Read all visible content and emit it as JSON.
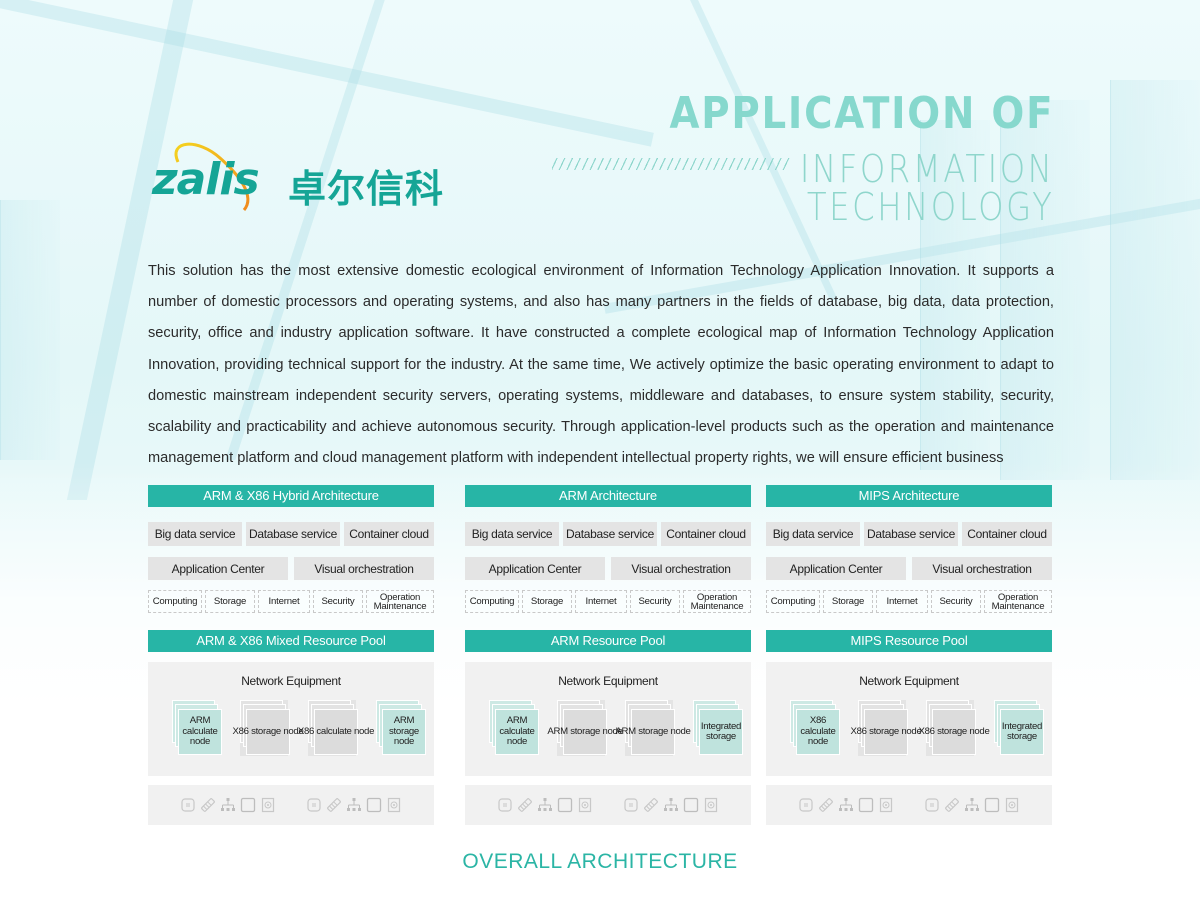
{
  "brand": {
    "logo_latin": "zalis",
    "logo_chinese": "卓尔信科",
    "logo_color": "#15a596",
    "accent_arc_colors": [
      "#f4d31f",
      "#f08a1d"
    ]
  },
  "headline": {
    "line1": "APPLICATION OF",
    "line2": "INFORMATION",
    "line3": "TECHNOLOGY",
    "decoration": "hatch-stripes"
  },
  "intro_text": "This solution has the most extensive domestic ecological environment of Information Technology Application Innovation. It supports a number of domestic processors and operating systems, and also has many partners in the fields of database, big data, data protection, security, office and industry application software. It have constructed a complete ecological map of Information Technology Application Innovation, providing technical support for the industry. At the same time, We actively optimize the basic operating environment to adapt to domestic mainstream independent security servers, operating systems, middleware and databases, to ensure system stability, security, scalability and practicability and achieve autonomous security. Through application-level products such as the operation and maintenance management platform and cloud management platform with independent intellectual property rights, we will ensure efficient business",
  "colors": {
    "teal_bar": "#27b5a6",
    "headline": "#86d8cd",
    "caption": "#2bb5a5",
    "service_box": "#e4e4e4",
    "node_teal": "#bfe3dd",
    "node_gray": "#dcdcdc"
  },
  "architectures": [
    {
      "title": "ARM & X86 Hybrid Architecture",
      "services_row1": [
        "Big data service",
        "Database service",
        "Container cloud"
      ],
      "services_row2": [
        "Application Center",
        "Visual orchestration"
      ],
      "capabilities": [
        "Computing",
        "Storage",
        "Internet",
        "Security",
        "Operation Maintenance"
      ],
      "pool_title": "ARM & X86 Mixed Resource Pool",
      "network_label": "Network Equipment",
      "nodes": [
        {
          "label": "ARM calculate node",
          "style": "teal"
        },
        {
          "label": "X86 storage node",
          "style": "gray"
        },
        {
          "label": "X86 calculate node",
          "style": "gray"
        },
        {
          "label": "ARM storage node",
          "style": "teal"
        }
      ],
      "hardware_icons": [
        "cpu-icon",
        "memory-icon",
        "network-topology-icon",
        "disk-box-icon",
        "hard-drive-icon"
      ]
    },
    {
      "title": "ARM Architecture",
      "services_row1": [
        "Big data service",
        "Database service",
        "Container cloud"
      ],
      "services_row2": [
        "Application Center",
        "Visual orchestration"
      ],
      "capabilities": [
        "Computing",
        "Storage",
        "Internet",
        "Security",
        "Operation Maintenance"
      ],
      "pool_title": "ARM Resource Pool",
      "network_label": "Network Equipment",
      "nodes": [
        {
          "label": "ARM calculate node",
          "style": "teal"
        },
        {
          "label": "ARM storage node",
          "style": "gray"
        },
        {
          "label": "ARM storage node",
          "style": "gray"
        },
        {
          "label": "Integrated storage",
          "style": "teal"
        }
      ],
      "hardware_icons": [
        "cpu-icon",
        "memory-icon",
        "network-topology-icon",
        "disk-box-icon",
        "hard-drive-icon"
      ]
    },
    {
      "title": "MIPS Architecture",
      "services_row1": [
        "Big data service",
        "Database service",
        "Container cloud"
      ],
      "services_row2": [
        "Application Center",
        "Visual orchestration"
      ],
      "capabilities": [
        "Computing",
        "Storage",
        "Internet",
        "Security",
        "Operation Maintenance"
      ],
      "pool_title": "MIPS Resource Pool",
      "network_label": "Network Equipment",
      "nodes": [
        {
          "label": "X86 calculate node",
          "style": "teal"
        },
        {
          "label": "X86 storage node",
          "style": "gray"
        },
        {
          "label": "X86 storage node",
          "style": "gray"
        },
        {
          "label": "Integrated storage",
          "style": "teal"
        }
      ],
      "hardware_icons": [
        "cpu-icon",
        "memory-icon",
        "network-topology-icon",
        "disk-box-icon",
        "hard-drive-icon"
      ]
    }
  ],
  "caption": "OVERALL ARCHITECTURE"
}
